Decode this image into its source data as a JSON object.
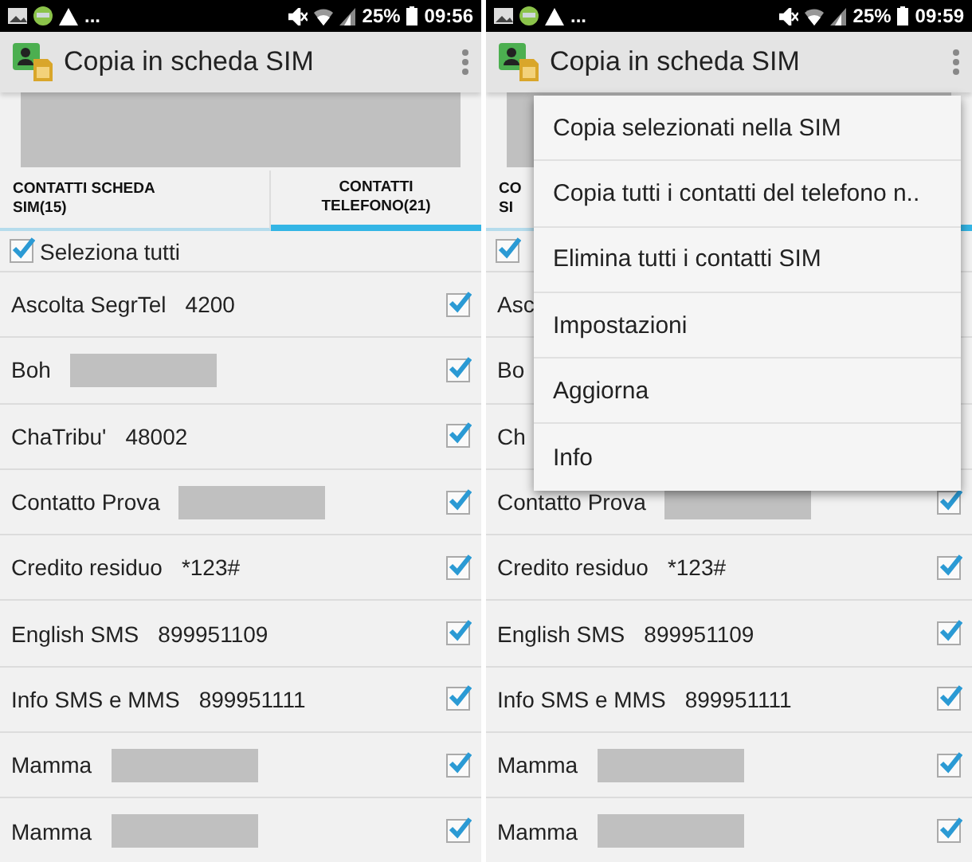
{
  "screens": [
    {
      "status_bar": {
        "more": "...",
        "battery": "25%",
        "time": "09:56"
      },
      "app_bar": {
        "title": "Copia in scheda SIM"
      },
      "tabs": [
        {
          "label": "CONTATTI SCHEDA SIM(15)",
          "selected": false
        },
        {
          "label": "CONTATTI TELEFONO(21)",
          "selected": true
        }
      ],
      "select_all": {
        "label": "Seleziona tutti",
        "checked": true
      },
      "contacts": [
        {
          "name": "Ascolta SegrTel",
          "kind": "number",
          "number": "4200",
          "checked": true
        },
        {
          "name": "Boh",
          "kind": "redacted",
          "checked": true
        },
        {
          "name": "ChaTribu'",
          "kind": "number",
          "number": "48002",
          "checked": true
        },
        {
          "name": "Contatto Prova",
          "kind": "redacted",
          "checked": true
        },
        {
          "name": "Credito residuo",
          "kind": "number",
          "number": "*123#",
          "checked": true
        },
        {
          "name": "English SMS",
          "kind": "number",
          "number": "899951109",
          "checked": true
        },
        {
          "name": "Info SMS e MMS",
          "kind": "number",
          "number": "899951111",
          "checked": true
        },
        {
          "name": "Mamma",
          "kind": "redacted",
          "checked": true
        },
        {
          "name": "Mamma",
          "kind": "redacted",
          "checked": true
        }
      ]
    },
    {
      "status_bar": {
        "more": "...",
        "battery": "25%",
        "time": "09:59"
      },
      "app_bar": {
        "title": "Copia in scheda SIM"
      },
      "tabs": [
        {
          "label": "CO\nSI",
          "selected": false
        },
        {
          "selected": true
        }
      ],
      "select_all": {
        "checked": true
      },
      "contacts": [
        {
          "name": "Asc"
        },
        {
          "name": "Bo"
        },
        {
          "name": "Ch"
        },
        {
          "name": "Contatto Prova",
          "kind": "redacted",
          "checked": true
        },
        {
          "name": "Credito residuo",
          "kind": "number",
          "number": "*123#",
          "checked": true
        },
        {
          "name": "English SMS",
          "kind": "number",
          "number": "899951109",
          "checked": true
        },
        {
          "name": "Info SMS e MMS",
          "kind": "number",
          "number": "899951111",
          "checked": true
        },
        {
          "name": "Mamma",
          "kind": "redacted",
          "checked": true
        },
        {
          "name": "Mamma",
          "kind": "redacted",
          "checked": true
        }
      ],
      "menu": {
        "items": [
          "Copia selezionati nella SIM",
          "Copia tutti i contatti del telefono n..",
          "Elimina tutti i contatti SIM",
          "Impostazioni",
          "Aggiorna",
          "Info"
        ]
      }
    }
  ]
}
